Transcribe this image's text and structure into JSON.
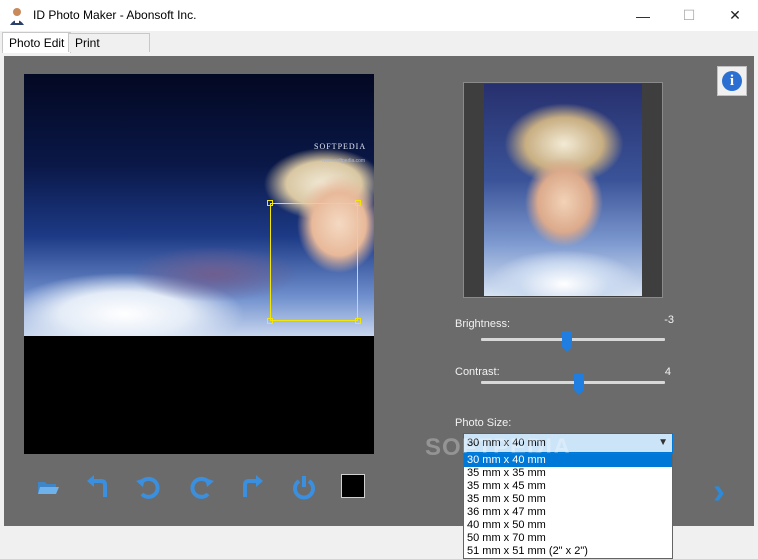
{
  "window": {
    "title": "ID Photo Maker - Abonsoft Inc.",
    "minimize_glyph": "—",
    "maximize_glyph": "☐",
    "close_glyph": "✕"
  },
  "tabs": [
    {
      "label": "Photo Edit",
      "active": true
    },
    {
      "label": "Print Preview",
      "active": false
    }
  ],
  "photo": {
    "watermark_title": "SOFTPEDIA",
    "watermark_url": "www.softpedia.com"
  },
  "adjustments": {
    "brightness": {
      "label": "Brightness:",
      "value": "-3",
      "level": 0.47
    },
    "contrast": {
      "label": "Contrast:",
      "value": "4",
      "level": 0.53
    }
  },
  "photo_size": {
    "label": "Photo Size:",
    "selected": "30 mm x 40 mm",
    "options": [
      "30 mm x 40 mm",
      "35 mm x 35 mm",
      "35 mm x 45 mm",
      "35 mm x 50 mm",
      "36 mm x 47 mm",
      "40 mm x 50 mm",
      "50 mm x 70 mm",
      "51 mm x 51 mm (2\" x 2\")"
    ]
  },
  "overlay_watermark": "SOFTPEDIA",
  "toolbar": {
    "icons": [
      "open-folder-icon",
      "undo-icon",
      "rotate-left-icon",
      "rotate-right-icon",
      "redo-icon",
      "power-icon"
    ],
    "swatch_color": "#000000"
  },
  "colors": {
    "panel_bg": "#6b6b6b",
    "accent": "#1f7ee0",
    "crop_frame": "#f5e600"
  }
}
